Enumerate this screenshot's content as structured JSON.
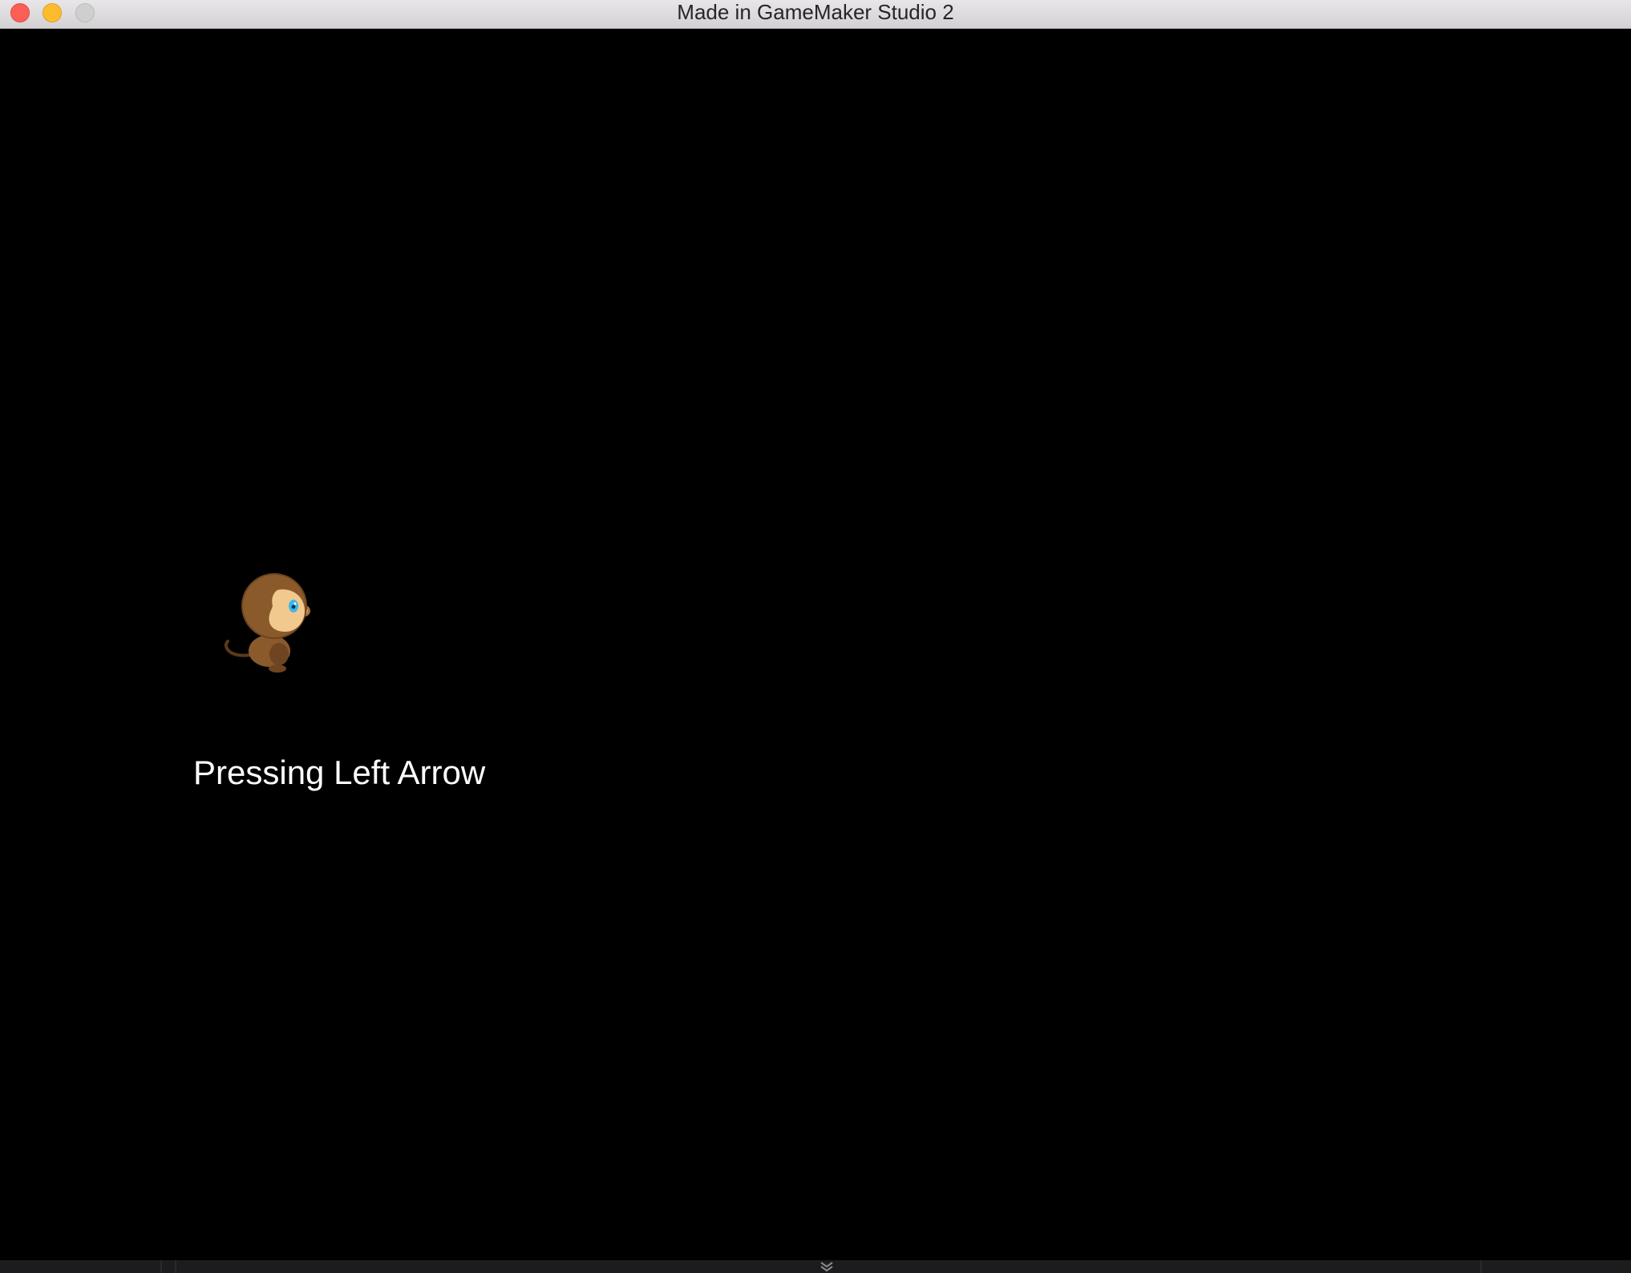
{
  "window": {
    "title": "Made in GameMaker Studio 2"
  },
  "game": {
    "status_text": "Pressing Left Arrow",
    "character": "monkey-sprite"
  },
  "colors": {
    "background": "#000000",
    "text": "#ffffff",
    "monkey_fur": "#8a5a2b",
    "monkey_face": "#f1c98e",
    "monkey_eye": "#3fb6e8"
  },
  "icons": {
    "bottom": "chevron-down-double-icon"
  }
}
